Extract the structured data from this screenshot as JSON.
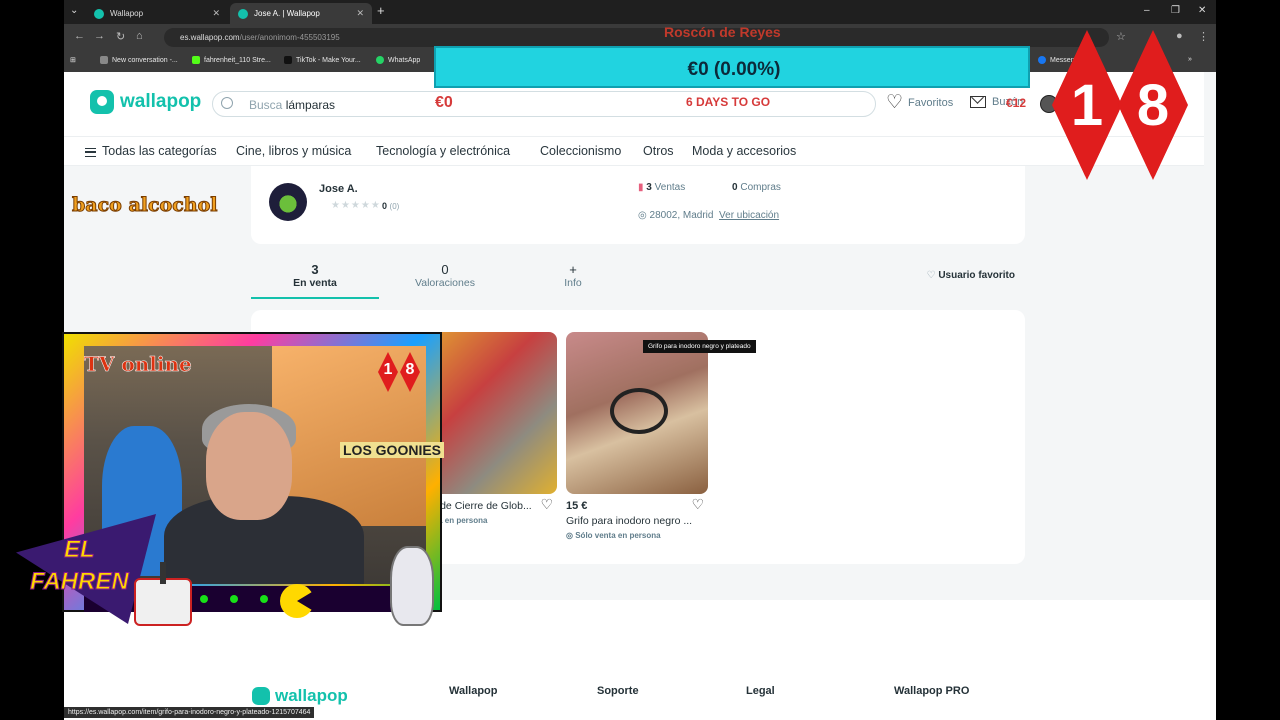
{
  "browser": {
    "tabs": [
      {
        "label": "Wallapop"
      },
      {
        "label": "Jose A. | Wallapop"
      }
    ],
    "url_host": "es.wallapop.com",
    "url_path": "/user/anonimom-455503195",
    "bookmarks": [
      "New conversation -...",
      "fahrenheit_110 Stre...",
      "TikTok - Make Your...",
      "WhatsApp",
      "Messen...rebo..."
    ],
    "status_url": "https://es.wallapop.com/item/grifo-para-inodoro-negro-y-plateado-1215707464"
  },
  "header": {
    "logo": "wallapop",
    "search_prefix": "Busca",
    "search_highlight": "lámparas",
    "favorites": "Favoritos",
    "mailbox": "Buzón"
  },
  "categories": {
    "all": "Todas las categorías",
    "items": [
      "Cine, libros y música",
      "Tecnología y electrónica",
      "Coleccionismo",
      "Otros",
      "Moda y accesorios"
    ]
  },
  "profile": {
    "name": "Jose A.",
    "rating": "0",
    "rating_count": "(0)",
    "sales_num": "3",
    "sales_label": "Ventas",
    "purchases_num": "0",
    "purchases_label": "Compras",
    "location": "28002, Madrid",
    "location_link": "Ver ubicación"
  },
  "tabs": [
    {
      "num": "3",
      "label": "En venta"
    },
    {
      "num": "0",
      "label": "Valoraciones"
    },
    {
      "num": "+",
      "label": "Info"
    }
  ],
  "favorite_user": "Usuario favorito",
  "items": [
    {
      "price": "",
      "title": "...las de Cierre de Glob...",
      "ship": "...venta en persona"
    },
    {
      "price": "15 €",
      "title": "Grifo para inodoro negro ...",
      "ship": "Sólo venta en persona"
    }
  ],
  "tooltip": "Grifo para inodoro negro y plateado",
  "footer": {
    "logo": "wallapop",
    "cols": [
      "Wallapop",
      "Soporte",
      "Legal",
      "Wallapop PRO"
    ]
  },
  "overlay": {
    "goal_title": "Roscón de Reyes",
    "goal_progress": "€0 (0.00%)",
    "goal_progress_fraction": 0,
    "goal_current": "€0",
    "goal_days": "6 DAYS TO GO",
    "goal_target": "€12",
    "marquee": "baco alcochol",
    "age_digit_1": "1",
    "age_digit_2": "8",
    "cam_title": "TV online",
    "cam_poster": "LOS GOONIES",
    "brand_line1": "EL",
    "brand_line2": "FAHREN"
  },
  "colors": {
    "brand": "#13c1ac",
    "goal_bar": "#21d3e0",
    "goal_text": "#d63a3a",
    "diamond": "#e01d1d"
  }
}
